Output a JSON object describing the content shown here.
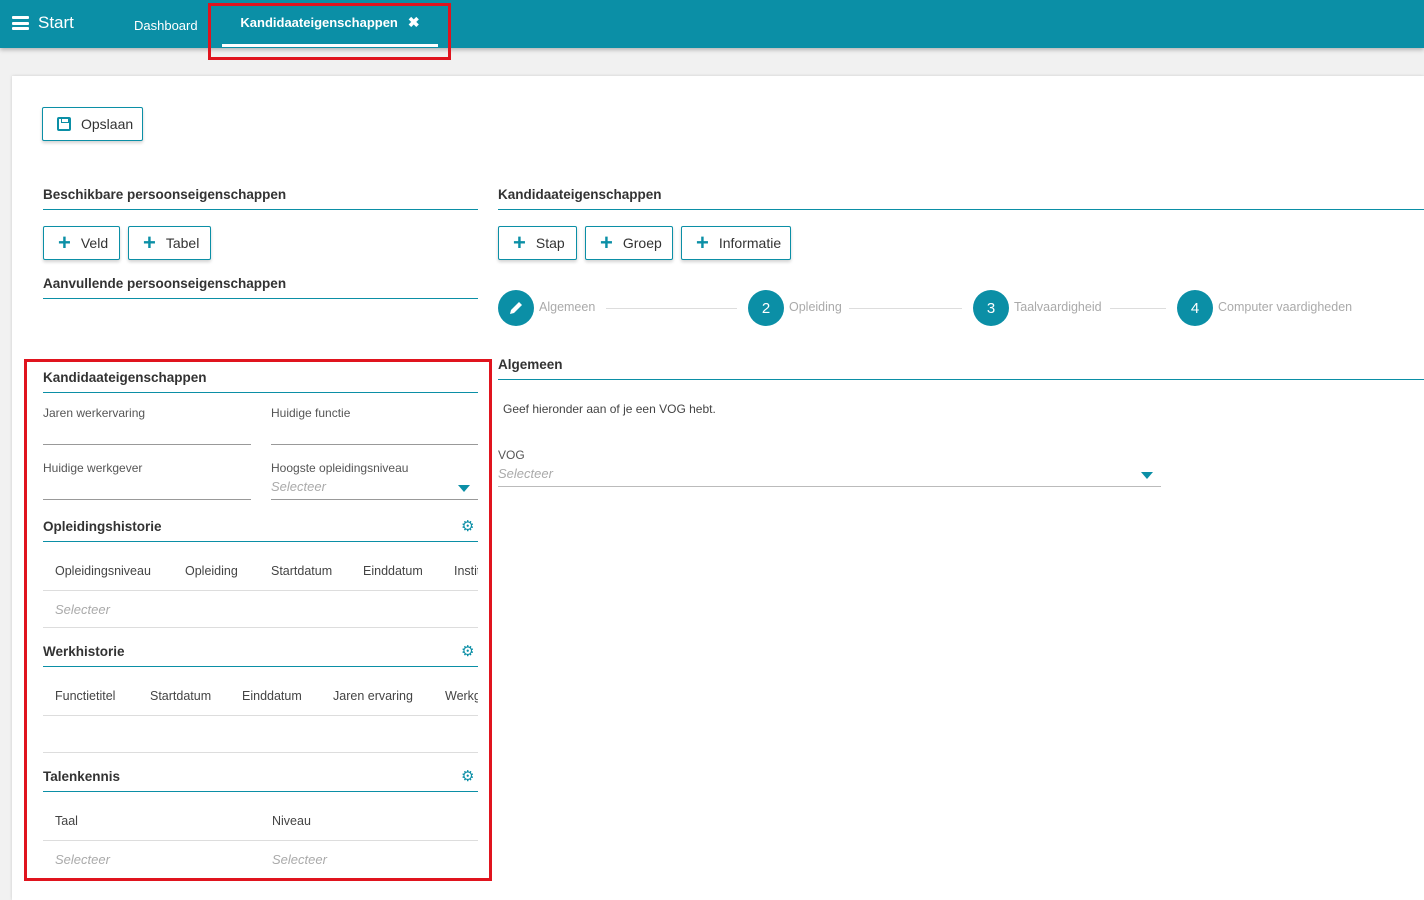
{
  "topbar": {
    "menu_label": "Start",
    "tabs": [
      {
        "label": "Dashboard"
      },
      {
        "label": "Kandidaateigenschappen",
        "close": "✖"
      }
    ]
  },
  "toolbar": {
    "save_label": "Opslaan"
  },
  "left": {
    "available_title": "Beschikbare persoonseigenschappen",
    "btn_field": "Veld",
    "btn_table": "Tabel",
    "additional_title": "Aanvullende persoonseigenschappen",
    "candidate": {
      "title": "Kandidaateigenschappen",
      "fields": {
        "years_experience": "Jaren werkervaring",
        "current_function": "Huidige functie",
        "current_employer": "Huidige werkgever",
        "highest_education": "Hoogste opleidingsniveau",
        "highest_education_placeholder": "Selecteer"
      },
      "education": {
        "title": "Opleidingshistorie",
        "columns": [
          "Opleidingsniveau",
          "Opleiding",
          "Startdatum",
          "Einddatum",
          "Instituut"
        ],
        "row_placeholder": "Selecteer"
      },
      "work": {
        "title": "Werkhistorie",
        "columns": [
          "Functietitel",
          "Startdatum",
          "Einddatum",
          "Jaren ervaring",
          "Werkgever"
        ]
      },
      "languages": {
        "title": "Talenkennis",
        "columns": [
          "Taal",
          "Niveau"
        ],
        "row_placeholders": [
          "Selecteer",
          "Selecteer"
        ]
      }
    }
  },
  "right": {
    "title": "Kandidaateigenschappen",
    "btn_step": "Stap",
    "btn_group": "Groep",
    "btn_info": "Informatie",
    "steps": [
      {
        "num": "",
        "label": "Algemeen"
      },
      {
        "num": "2",
        "label": "Opleiding"
      },
      {
        "num": "3",
        "label": "Taalvaardigheid"
      },
      {
        "num": "4",
        "label": "Computer vaardigheden"
      }
    ],
    "section_title": "Algemeen",
    "info_text": "Geef hieronder aan of je een VOG hebt.",
    "vog_label": "VOG",
    "vog_placeholder": "Selecteer"
  },
  "colors": {
    "accent": "#0b8fa6",
    "highlight": "#e0141e"
  }
}
